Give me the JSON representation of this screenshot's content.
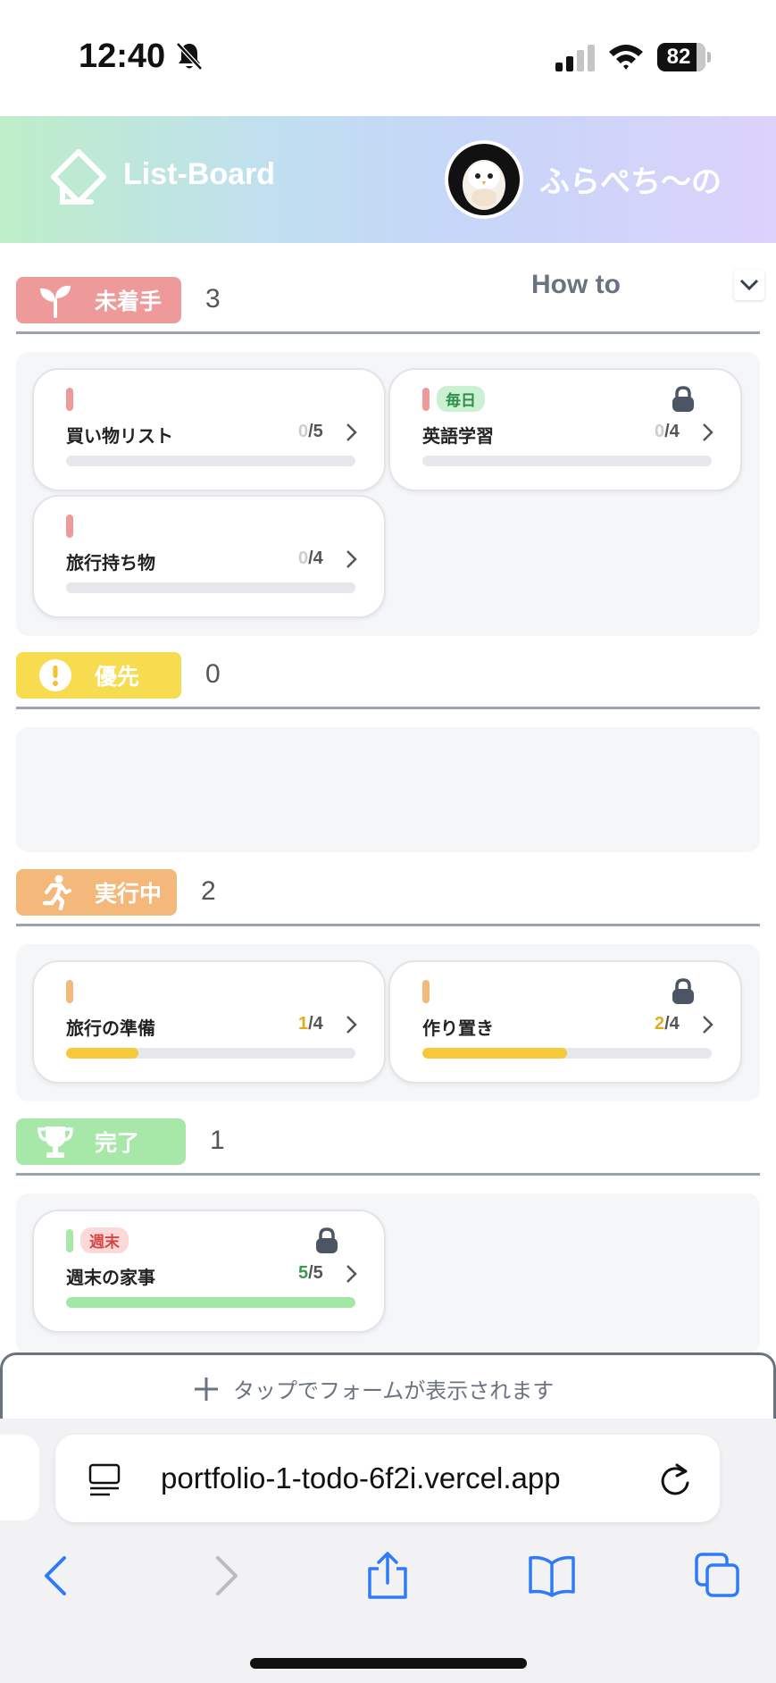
{
  "status_bar": {
    "time": "12:40",
    "battery": "82"
  },
  "header": {
    "app_title": "List-Board",
    "user_name": "ふらぺち〜の"
  },
  "howto": {
    "label": "How to"
  },
  "colors": {
    "todo": "#ef9a9a",
    "priority": "#f7dc4f",
    "doing": "#f4b97a",
    "done": "#a7e8a9",
    "progress_yellow": "#f5c93b",
    "progress_green": "#a1e8a4"
  },
  "sections": {
    "todo": {
      "label": "未着手",
      "count": "3",
      "cards": [
        {
          "title": "買い物リスト",
          "done": "0",
          "total": "/5",
          "progress": 0,
          "tag": "",
          "locked": false
        },
        {
          "title": "英語学習",
          "done": "0",
          "total": "/4",
          "progress": 0,
          "tag": "毎日",
          "locked": true
        },
        {
          "title": "旅行持ち物",
          "done": "0",
          "total": "/4",
          "progress": 0,
          "tag": "",
          "locked": false
        }
      ]
    },
    "priority": {
      "label": "優先",
      "count": "0",
      "cards": []
    },
    "doing": {
      "label": "実行中",
      "count": "2",
      "cards": [
        {
          "title": "旅行の準備",
          "done": "1",
          "total": "/4",
          "progress": 0.25,
          "tag": "",
          "locked": false
        },
        {
          "title": "作り置き",
          "done": "2",
          "total": "/4",
          "progress": 0.5,
          "tag": "",
          "locked": true
        }
      ]
    },
    "done": {
      "label": "完了",
      "count": "1",
      "cards": [
        {
          "title": "週末の家事",
          "done": "5",
          "total": "/5",
          "progress": 1,
          "tag": "週末",
          "locked": true
        }
      ]
    }
  },
  "form_bar": {
    "label": "タップでフォームが表示されます"
  },
  "browser": {
    "url": "portfolio-1-todo-6f2i.vercel.app"
  }
}
